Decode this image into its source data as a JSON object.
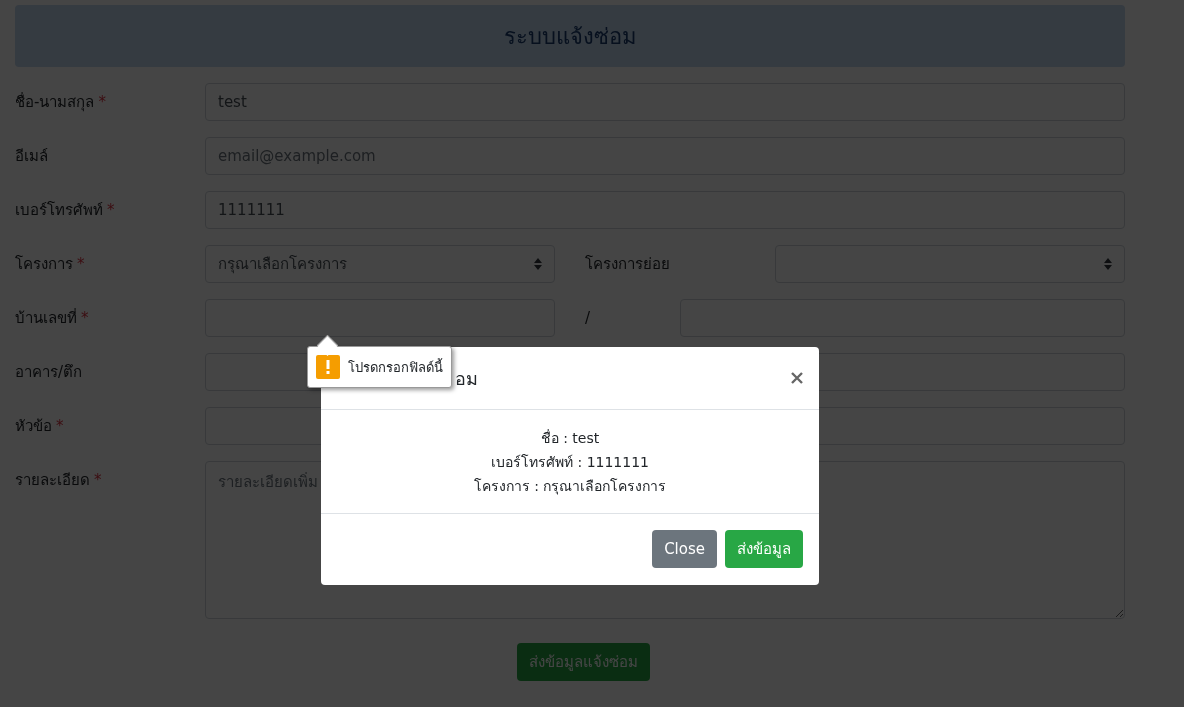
{
  "header": {
    "title": "ระบบแจ้งซ่อม"
  },
  "form": {
    "rows": [
      {
        "kind": "input",
        "label": "ชื่อ-นามสกุล",
        "required_mark": "*",
        "value": "test"
      },
      {
        "kind": "input",
        "label": "อีเมล์",
        "placeholder": "email@example.com"
      },
      {
        "kind": "input",
        "label": "เบอร์โทรศัพท์",
        "required_mark": "*",
        "value": "1111111"
      },
      {
        "kind": "select-pair",
        "label": "โครงการ",
        "required_mark": "*",
        "value": "กรุณาเลือกโครงการ",
        "second_label": "โครงการย่อย"
      },
      {
        "kind": "input-pair",
        "label": "บ้านเลขที่",
        "required_mark": "*",
        "second_label": "/"
      },
      {
        "kind": "input-pair",
        "label": "อาคาร/ตึก"
      },
      {
        "kind": "input",
        "label": "หัวข้อ",
        "required_mark": "*"
      },
      {
        "kind": "textarea",
        "label": "รายละเอียด",
        "required_mark": "*",
        "placeholder": "รายละเอียดเพิ่ม"
      }
    ],
    "submit": "ส่งข้อมูลแจ้งซ่อม"
  },
  "modal": {
    "title": "อม",
    "lines": [
      "ชื่อ : test",
      "เบอร์โทรศัพท์ : 1111111",
      "โครงการ : กรุณาเลือกโครงการ"
    ],
    "buttons": [
      {
        "label": "Close",
        "kind": "secondary"
      },
      {
        "label": "ส่งข้อมูล",
        "kind": "primary"
      }
    ]
  },
  "tooltip": {
    "text": "โปรดกรอกฟิลด์นี้"
  }
}
